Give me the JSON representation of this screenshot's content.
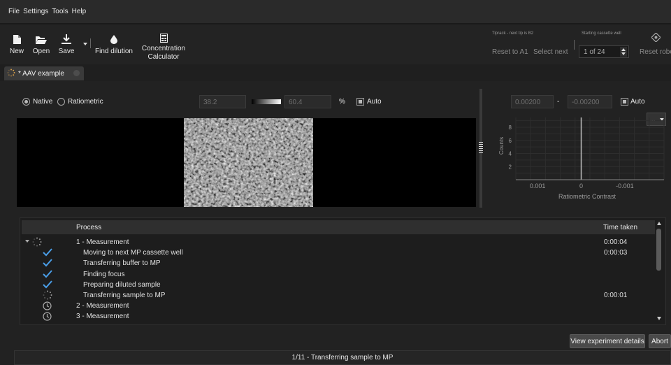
{
  "menu": [
    "File",
    "Settings",
    "Tools",
    "Help"
  ],
  "toolbar": {
    "new_label": "New",
    "open_label": "Open",
    "save_label": "Save",
    "find_dilution_label": "Find dilution",
    "conc_calc_label_line1": "Concentration",
    "conc_calc_label_line2": "Calculator"
  },
  "tiprack": {
    "title": "Tiprack - next tip is B2",
    "reset_label": "Reset to A1",
    "select_next_label": "Select next"
  },
  "cassette": {
    "title": "Starting cassette well",
    "value": "1 of 24"
  },
  "robot": {
    "reset_label": "Reset robo"
  },
  "tab": {
    "label": "* AAV example"
  },
  "image_controls": {
    "native_label": "Native",
    "ratiometric_label": "Ratiometric",
    "selected_mode": "Native",
    "min_value": "38.2",
    "max_value": "60.4",
    "unit": "%",
    "auto_label": "Auto",
    "auto_checked": true
  },
  "histogram_controls": {
    "min_value": "0.00200",
    "separator": "-",
    "max_value": "-0.00200",
    "auto_label": "Auto",
    "auto_checked": true,
    "menu_label": "..."
  },
  "chart_data": {
    "type": "bar",
    "xlabel": "Ratiometric Contrast",
    "ylabel": "Counts",
    "x_ticks": [
      "0.001",
      "0",
      "-0.001"
    ],
    "y_ticks": [
      "2",
      "4",
      "6",
      "8"
    ],
    "x_reversed": true,
    "xlim": [
      0.0015,
      -0.0019
    ],
    "ylim": [
      0,
      9.5
    ],
    "grid": true,
    "marker_x": 0,
    "values": []
  },
  "table": {
    "col_process": "Process",
    "col_time": "Time taken",
    "rows": [
      {
        "text": "1 - Measurement",
        "time": "0:00:04",
        "status": "running",
        "level": 0
      },
      {
        "text": "Moving to next MP cassette well",
        "time": "0:00:03",
        "status": "done",
        "level": 1
      },
      {
        "text": "Transferring buffer to MP",
        "time": "",
        "status": "done",
        "level": 1
      },
      {
        "text": "Finding focus",
        "time": "",
        "status": "done",
        "level": 1
      },
      {
        "text": "Preparing diluted sample",
        "time": "",
        "status": "done",
        "level": 1
      },
      {
        "text": "Transferring sample to MP",
        "time": "0:00:01",
        "status": "running",
        "level": 1
      },
      {
        "text": "2 - Measurement",
        "time": "",
        "status": "pending",
        "level": 0
      },
      {
        "text": "3 - Measurement",
        "time": "",
        "status": "pending",
        "level": 0
      }
    ]
  },
  "buttons": {
    "view_details_label": "View experiment details",
    "abort_label": "Abort"
  },
  "status": {
    "text": "1/11 - Transferring sample to MP"
  },
  "colors": {
    "check": "#4a9ee8",
    "background": "#222222"
  }
}
